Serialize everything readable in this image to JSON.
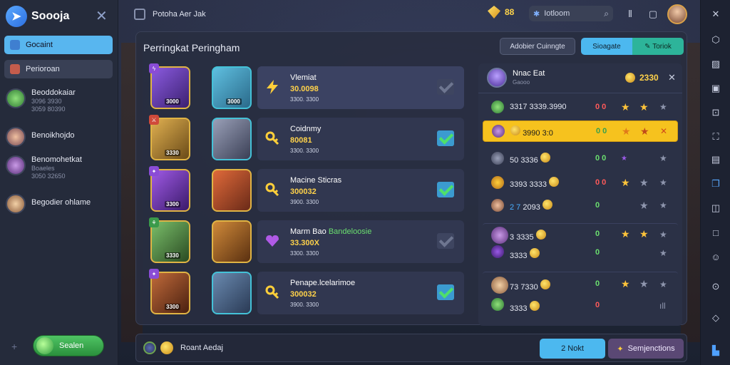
{
  "app": {
    "brand": "Soooja",
    "window_title": "Potoha Aer Jak"
  },
  "sidebar": {
    "items": [
      {
        "label": "Gocaint",
        "active": true
      },
      {
        "label": "Perioroan",
        "active": false
      }
    ],
    "contacts": [
      {
        "name": "Beoddokaiar",
        "sub1": "3096 3930",
        "sub2": "3059 80390"
      },
      {
        "name": "Benoikhojdo",
        "sub1": "",
        "sub2": ""
      },
      {
        "name": "Benomohetkat",
        "sub1": "Boaeles",
        "sub2": "3050 32650"
      },
      {
        "name": "Begodier ohlame",
        "sub1": "",
        "sub2": ""
      }
    ],
    "bottom_button": "Sealen"
  },
  "topbar": {
    "currency_value": "88",
    "search_value": "Iotloom",
    "icons": [
      "library-icon",
      "notes-icon"
    ]
  },
  "panel": {
    "title": "Perringkat Peringham",
    "sort_button": "Adobier Cuinngte",
    "toggle": {
      "left": "Sioagate",
      "right": "Toriok"
    }
  },
  "heroes": [
    {
      "name": "Vlemiat",
      "name_extra": "",
      "stat": "30.0098",
      "sub": "3300. 3300",
      "level1": "3000",
      "level2": "3000",
      "checked": false
    },
    {
      "name": "Coidnmy",
      "name_extra": "",
      "stat": "80081",
      "sub": "3300. 3300",
      "level1": "3330",
      "level2": "",
      "checked": true
    },
    {
      "name": "Macine Sticras",
      "name_extra": "",
      "stat": "300032",
      "sub": "3900. 3300",
      "level1": "3300",
      "level2": "",
      "checked": true
    },
    {
      "name": "Marm Bao",
      "name_extra": "Bandeloosie",
      "stat": "33.300X",
      "sub": "3300. 3300",
      "level1": "3330",
      "level2": "",
      "checked": false
    },
    {
      "name": "Penape.lcelarimoe",
      "name_extra": "",
      "stat": "300032",
      "sub": "3900. 3300",
      "level1": "3300",
      "level2": "",
      "checked": true
    }
  ],
  "board": {
    "header_name": "Nnac Eat",
    "header_sub": "Gaooo",
    "header_points": "2330",
    "rows": [
      {
        "level": "3317",
        "score": "3339.3990",
        "pts": "0 0",
        "stars": [
          "★",
          "★",
          "★"
        ],
        "highlight": false
      },
      {
        "level": "3990",
        "score": "3:0",
        "pts": "0 0",
        "stars": [
          "★",
          "★",
          "✕"
        ],
        "highlight": true
      },
      {
        "level": "50",
        "score": "3336",
        "pts": "0 0",
        "stars": [
          "★",
          "",
          "★"
        ],
        "highlight": false
      },
      {
        "level": "3393",
        "score": "3333",
        "pts": "0 0",
        "stars": [
          "★",
          "★",
          "★"
        ],
        "highlight": false
      },
      {
        "level": "2 7",
        "score": "2093",
        "pts": "0",
        "stars": [
          "",
          "★",
          "★"
        ],
        "highlight": false
      },
      {
        "level": "3",
        "score": "3335",
        "pts": "0",
        "stars": [
          "★",
          "★",
          "★"
        ],
        "highlight": false
      },
      {
        "level": "",
        "score": "3333",
        "pts": "0",
        "stars": [
          "",
          "",
          "★"
        ],
        "highlight": false
      },
      {
        "level": "73",
        "score": "7330",
        "pts": "0",
        "stars": [
          "★",
          "★",
          "★"
        ],
        "highlight": false
      },
      {
        "level": "",
        "score": "3333",
        "pts": "0",
        "stars": [
          "",
          "",
          "ıll"
        ],
        "highlight": false
      }
    ]
  },
  "bottom": {
    "label": "Roant Aedaj",
    "next": "2 Nokt",
    "completions": "Semjenctions"
  },
  "colors": {
    "accent_blue": "#4cb8ef",
    "accent_teal": "#2db49a",
    "gold": "#f6c21e",
    "panel": "#282e40"
  }
}
